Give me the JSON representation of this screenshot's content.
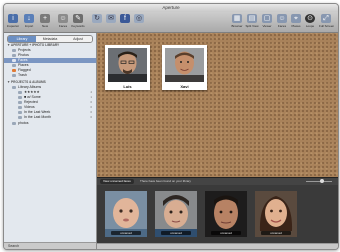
{
  "window": {
    "title": "Aperture"
  },
  "toolbar": {
    "left": [
      {
        "label": "Inspector",
        "icon": "info-icon"
      },
      {
        "label": "Import",
        "icon": "import-icon"
      },
      {
        "label": "New",
        "icon": "new-icon"
      },
      {
        "label": "Faces",
        "icon": "faces-icon"
      },
      {
        "label": "Keywords",
        "icon": "keywords-icon"
      },
      {
        "label": "",
        "icon": "rotate-icon"
      },
      {
        "label": "",
        "icon": "mail-icon"
      },
      {
        "label": "",
        "icon": "share-icon"
      },
      {
        "label": "",
        "icon": "web-icon"
      }
    ],
    "right": [
      {
        "label": "Browser",
        "icon": "browser-icon"
      },
      {
        "label": "Split View",
        "icon": "split-view-icon"
      },
      {
        "label": "Viewer",
        "icon": "viewer-icon"
      },
      {
        "label": "Faces",
        "icon": "faces-view-icon"
      },
      {
        "label": "Places",
        "icon": "places-icon"
      },
      {
        "label": "Loupe",
        "icon": "loupe-icon"
      },
      {
        "label": "Full Screen",
        "icon": "fullscreen-icon"
      }
    ]
  },
  "sidebar": {
    "tabs": [
      "Library",
      "Metadata",
      "Adjust"
    ],
    "sections": [
      {
        "label": "▼ APERTURE + IPHOTO LIBRARY"
      },
      {
        "label": "▼ PROJECTS & ALBUMS"
      }
    ],
    "library_items": [
      {
        "label": "Projects"
      },
      {
        "label": "Photos"
      },
      {
        "label": "Faces"
      },
      {
        "label": "Places"
      },
      {
        "label": "Flagged"
      },
      {
        "label": "Trash"
      }
    ],
    "album_items": [
      {
        "label": "Library Albums"
      },
      {
        "label": "★★★★★",
        "badge": "4"
      },
      {
        "label": "■ w/ Some",
        "badge": "1"
      },
      {
        "label": "Rejected",
        "badge": "0"
      },
      {
        "label": "Videos",
        "badge": "0"
      },
      {
        "label": "In the Last Week",
        "badge": "0"
      },
      {
        "label": "In the Last Month",
        "badge": "0"
      },
      {
        "label": "photos"
      }
    ],
    "footer": "Search"
  },
  "corkboard": {
    "faces": [
      {
        "name": "Luis"
      },
      {
        "name": "Xavi"
      }
    ]
  },
  "unnamed": {
    "tabs": [
      "View unnamed faces",
      "There have been found on your library"
    ],
    "labels": [
      "unnamed",
      "unnamed",
      "unnamed",
      "unnamed"
    ]
  },
  "colors": {
    "cork": "#a9825a",
    "selection": "#7b96c2",
    "toolbar_accent": "#4a6ea9"
  }
}
